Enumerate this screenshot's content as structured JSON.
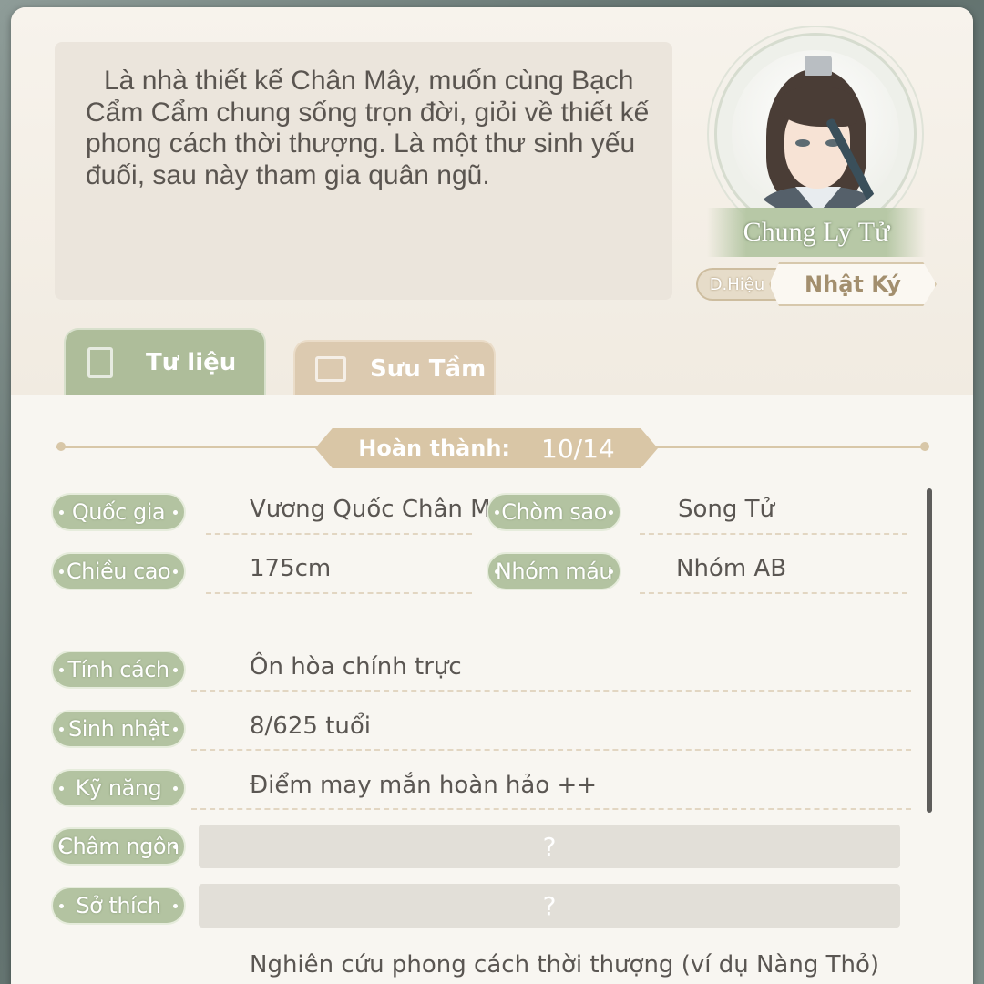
{
  "profile": {
    "description": "Là nhà thiết kế Chân Mây, muốn cùng Bạch Cẩm Cẩm chung sống trọn đời, giỏi về thiết kế phong cách thời thượng. Là một thư sinh yếu đuối, sau này tham gia quân ngũ.",
    "name": "Chung Ly Tử",
    "title_tag": "D.Hiệu",
    "diary_label": "Nhật Ký"
  },
  "tabs": [
    {
      "label": "Tư liệu",
      "icon": "document-icon",
      "active": true
    },
    {
      "label": "Sưu Tầm",
      "icon": "book-icon",
      "active": false
    }
  ],
  "progress": {
    "label": "Hoàn thành:",
    "value": "10/14"
  },
  "fields": {
    "country": {
      "label": "Quốc gia",
      "value": "Vương Quốc Chân Mây"
    },
    "constellation": {
      "label": "Chòm sao",
      "value": "Song Tử"
    },
    "height": {
      "label": "Chiều cao",
      "value": "175cm"
    },
    "blood_type": {
      "label": "Nhóm máu",
      "value": "Nhóm AB"
    },
    "personality": {
      "label": "Tính cách",
      "value": "Ôn hòa chính trực"
    },
    "birthday": {
      "label": "Sinh nhật",
      "value": "8/625 tuổi"
    },
    "skill": {
      "label": "Kỹ năng",
      "value": "Điểm may mắn hoàn hảo ++"
    },
    "motto": {
      "label": "Châm ngôn",
      "value": "?"
    },
    "hobby": {
      "label": "Sở thích",
      "value": "?"
    },
    "extra": {
      "value": "Nghiên cứu phong cách thời thượng (ví dụ Nàng Thỏ)"
    }
  },
  "colors": {
    "label_green": "#b3c3a1",
    "tab_tan": "#dccab0",
    "panel_bg": "#f6f2ea"
  }
}
